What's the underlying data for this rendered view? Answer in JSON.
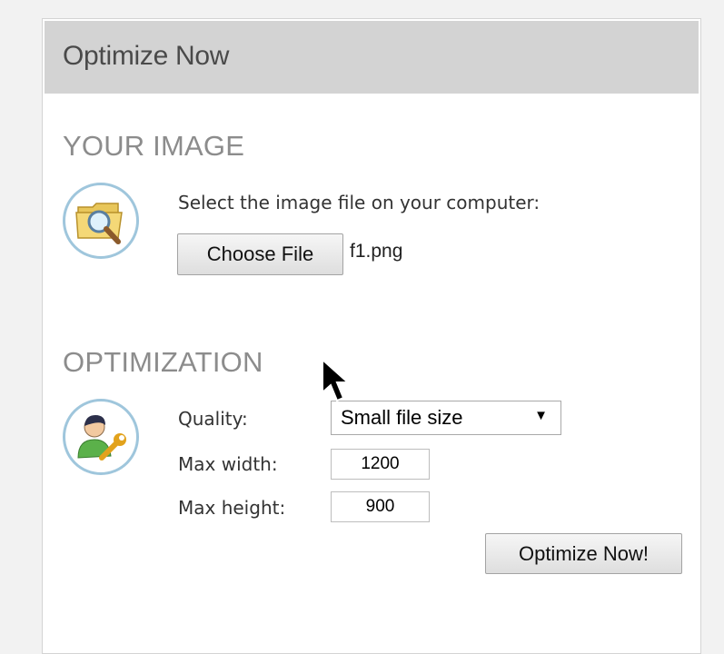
{
  "header": {
    "title": "Optimize Now"
  },
  "image_section": {
    "title": "YOUR IMAGE",
    "icon": "folder-search-icon",
    "prompt": "Select the image file on your computer:",
    "choose_file_label": "Choose File",
    "file_name": "f1.png"
  },
  "optimization_section": {
    "title": "OPTIMIZATION",
    "icon": "user-settings-icon",
    "quality_label": "Quality:",
    "quality_value": "Small file size",
    "quality_caret": "▼",
    "max_width_label": "Max width:",
    "max_width_value": "1200",
    "max_height_label": "Max height:",
    "max_height_value": "900",
    "submit_label": "Optimize Now!"
  },
  "colors": {
    "header_bg": "#d3d3d3",
    "section_title": "#8c8c8c",
    "icon_ring": "#9fc6dc"
  }
}
